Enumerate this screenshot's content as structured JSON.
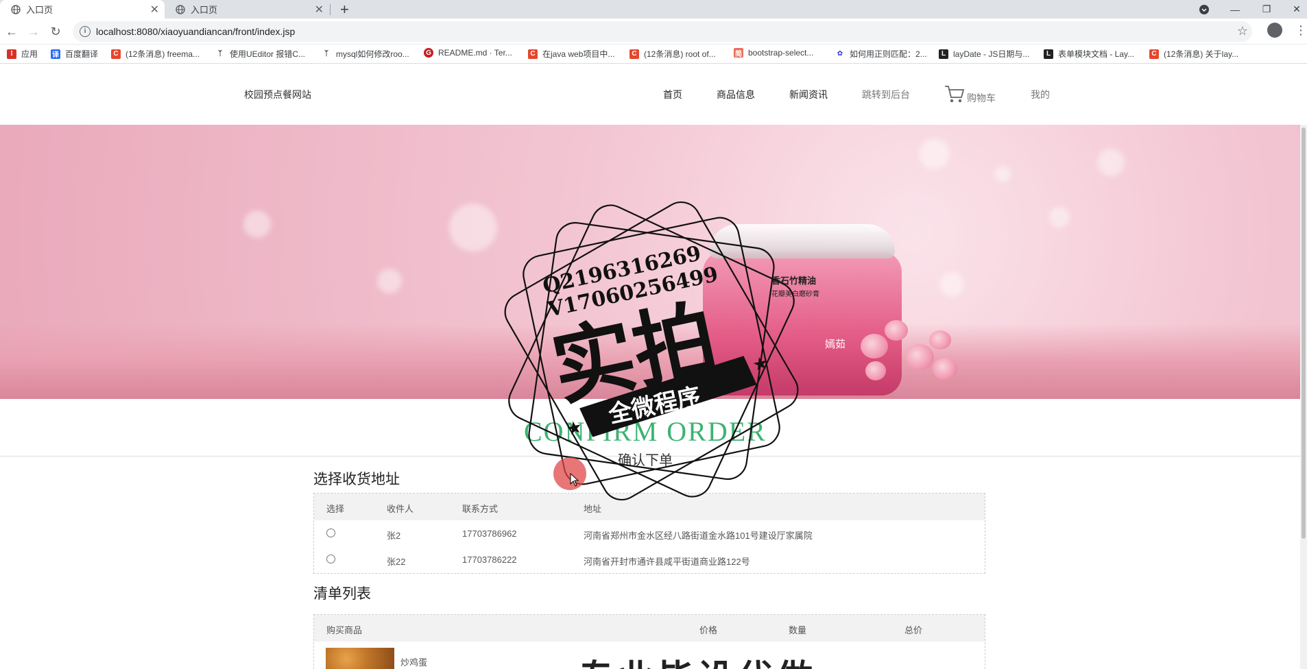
{
  "browser": {
    "tabs": [
      {
        "title": "入口页",
        "active": true
      },
      {
        "title": "入口页",
        "active": false
      }
    ],
    "url": "localhost:8080/xiaoyuandiancan/front/index.jsp",
    "bookmarks": [
      {
        "label": "应用",
        "icon": "apps-grid-icon",
        "color": "#d93025"
      },
      {
        "label": "百度翻译",
        "icon": "baidu-translate-icon",
        "color": "#2a6cf6"
      },
      {
        "label": "(12条消息) freema...",
        "icon": "csdn-icon",
        "color": "#e8452b"
      },
      {
        "label": "使用UEditor 报错C...",
        "icon": "leaf-icon",
        "color": "#333333"
      },
      {
        "label": "mysql如何修改roo...",
        "icon": "leaf-icon",
        "color": "#333333"
      },
      {
        "label": "README.md · Ter...",
        "icon": "gitee-icon",
        "color": "#c71d23"
      },
      {
        "label": "在java web项目中...",
        "icon": "csdn-icon",
        "color": "#e8452b"
      },
      {
        "label": "(12条消息) root of...",
        "icon": "csdn-icon",
        "color": "#e8452b"
      },
      {
        "label": "bootstrap-select...",
        "icon": "jianshu-icon",
        "color": "#ea6f5a"
      },
      {
        "label": "如何用正则匹配：2...",
        "icon": "baidu-paw-icon",
        "color": "#2932e1"
      },
      {
        "label": "layDate - JS日期与...",
        "icon": "layui-icon",
        "color": "#222222"
      },
      {
        "label": "表单模块文档 - Lay...",
        "icon": "layui-icon",
        "color": "#222222"
      },
      {
        "label": "(12条消息) 关于lay...",
        "icon": "csdn-icon",
        "color": "#e8452b"
      }
    ]
  },
  "site": {
    "logo": "校园预点餐网站",
    "nav": [
      "首页",
      "商品信息",
      "新闻资讯",
      "跳转到后台",
      "购物车",
      "我的"
    ]
  },
  "banner": {
    "product_name": "香石竹精油",
    "product_sub": "花瓣美白磨砂膏",
    "product_brand": "嫣茹"
  },
  "order": {
    "heading": "CONFIRM ORDER",
    "subheading": "确认下单",
    "address_title": "选择收货地址",
    "address_headers": [
      "选择",
      "收件人",
      "联系方式",
      "地址"
    ],
    "addresses": [
      {
        "name": "张2",
        "phone": "17703786962",
        "address": "河南省郑州市金水区经八路街道金水路101号建设厅家属院"
      },
      {
        "name": "张22",
        "phone": "17703786222",
        "address": "河南省开封市通许县咸平街道商业路122号"
      }
    ],
    "list_title": "清单列表",
    "list_headers": [
      "购买商品",
      "价格",
      "数量",
      "总价"
    ],
    "items": [
      {
        "name": "炒鸡蛋"
      }
    ]
  },
  "watermark": {
    "line1": "Q2196316269",
    "line2": "V17060256499",
    "big": "实拍",
    "ribbon": "全微程序",
    "bottom": "专业毕设代做"
  },
  "colors": {
    "confirm_green": "#3cb371",
    "banner_pink": "#f3c6d3"
  }
}
